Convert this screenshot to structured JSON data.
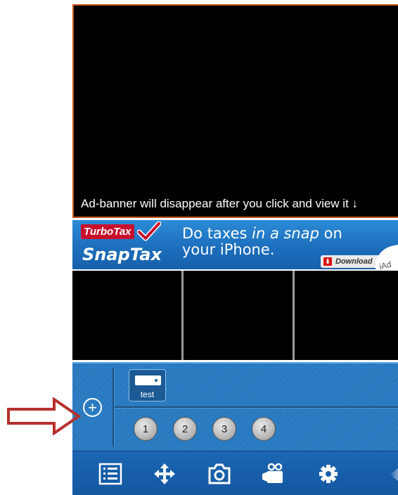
{
  "main_view": {
    "ad_notice": "Ad-banner will disappear after you click and view it ↓"
  },
  "ad_banner": {
    "brand_top": "TurboTax",
    "brand_bottom": "SnapTax",
    "headline_prefix": "Do taxes ",
    "headline_emphasis": "in a snap",
    "headline_suffix": " on your iPhone.",
    "download_label": "Download",
    "provider": "iAd"
  },
  "camera_list": {
    "add_icon": "plus-circle-icon",
    "items": [
      {
        "label": "test",
        "icon": "camera-dvr-icon"
      }
    ]
  },
  "page_buttons": [
    "1",
    "2",
    "3",
    "4"
  ],
  "toolbar": {
    "icons": [
      "list-icon",
      "move-arrows-icon",
      "camera-snapshot-icon",
      "video-record-icon",
      "gear-icon"
    ]
  },
  "colors": {
    "accent_blue": "#2a78bd",
    "annotation_arrow": "#b5302d",
    "main_view_border": "#c2571d"
  }
}
